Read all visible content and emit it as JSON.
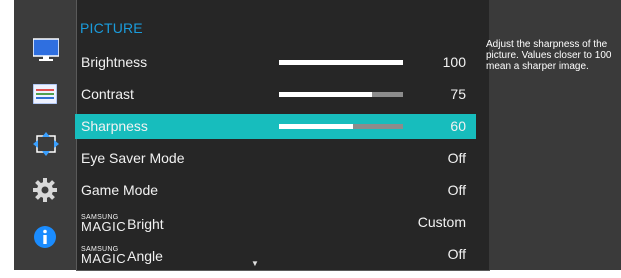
{
  "menu": {
    "title": "PICTURE",
    "items": [
      {
        "label": "Brightness",
        "value": "100",
        "level": 1.0
      },
      {
        "label": "Contrast",
        "value": "75",
        "level": 0.75
      },
      {
        "label": "Sharpness",
        "value": "60",
        "level": 0.6,
        "selected": true
      },
      {
        "label": "Eye Saver Mode",
        "value": "Off"
      },
      {
        "label": "Game Mode",
        "value": "Off"
      },
      {
        "label_prefix_top": "SAMSUNG",
        "label_prefix_main": "MAGIC",
        "label": "Bright",
        "value": "Custom"
      },
      {
        "label_prefix_top": "SAMSUNG",
        "label_prefix_main": "MAGIC",
        "label": "Angle",
        "value": "Off"
      }
    ],
    "scroll_indicator": "▼"
  },
  "sidebar": {
    "icons": [
      "monitor-icon",
      "settings-bars-icon",
      "resize-arrows-icon",
      "gear-icon",
      "info-icon"
    ]
  },
  "help": {
    "text": "Adjust the sharpness of the picture. Values closer to 100 mean a sharper image."
  },
  "colors": {
    "accent": "#1a9cdc",
    "selection": "#17bdbd",
    "panel": "#262626",
    "background": "#3a3a3a"
  }
}
